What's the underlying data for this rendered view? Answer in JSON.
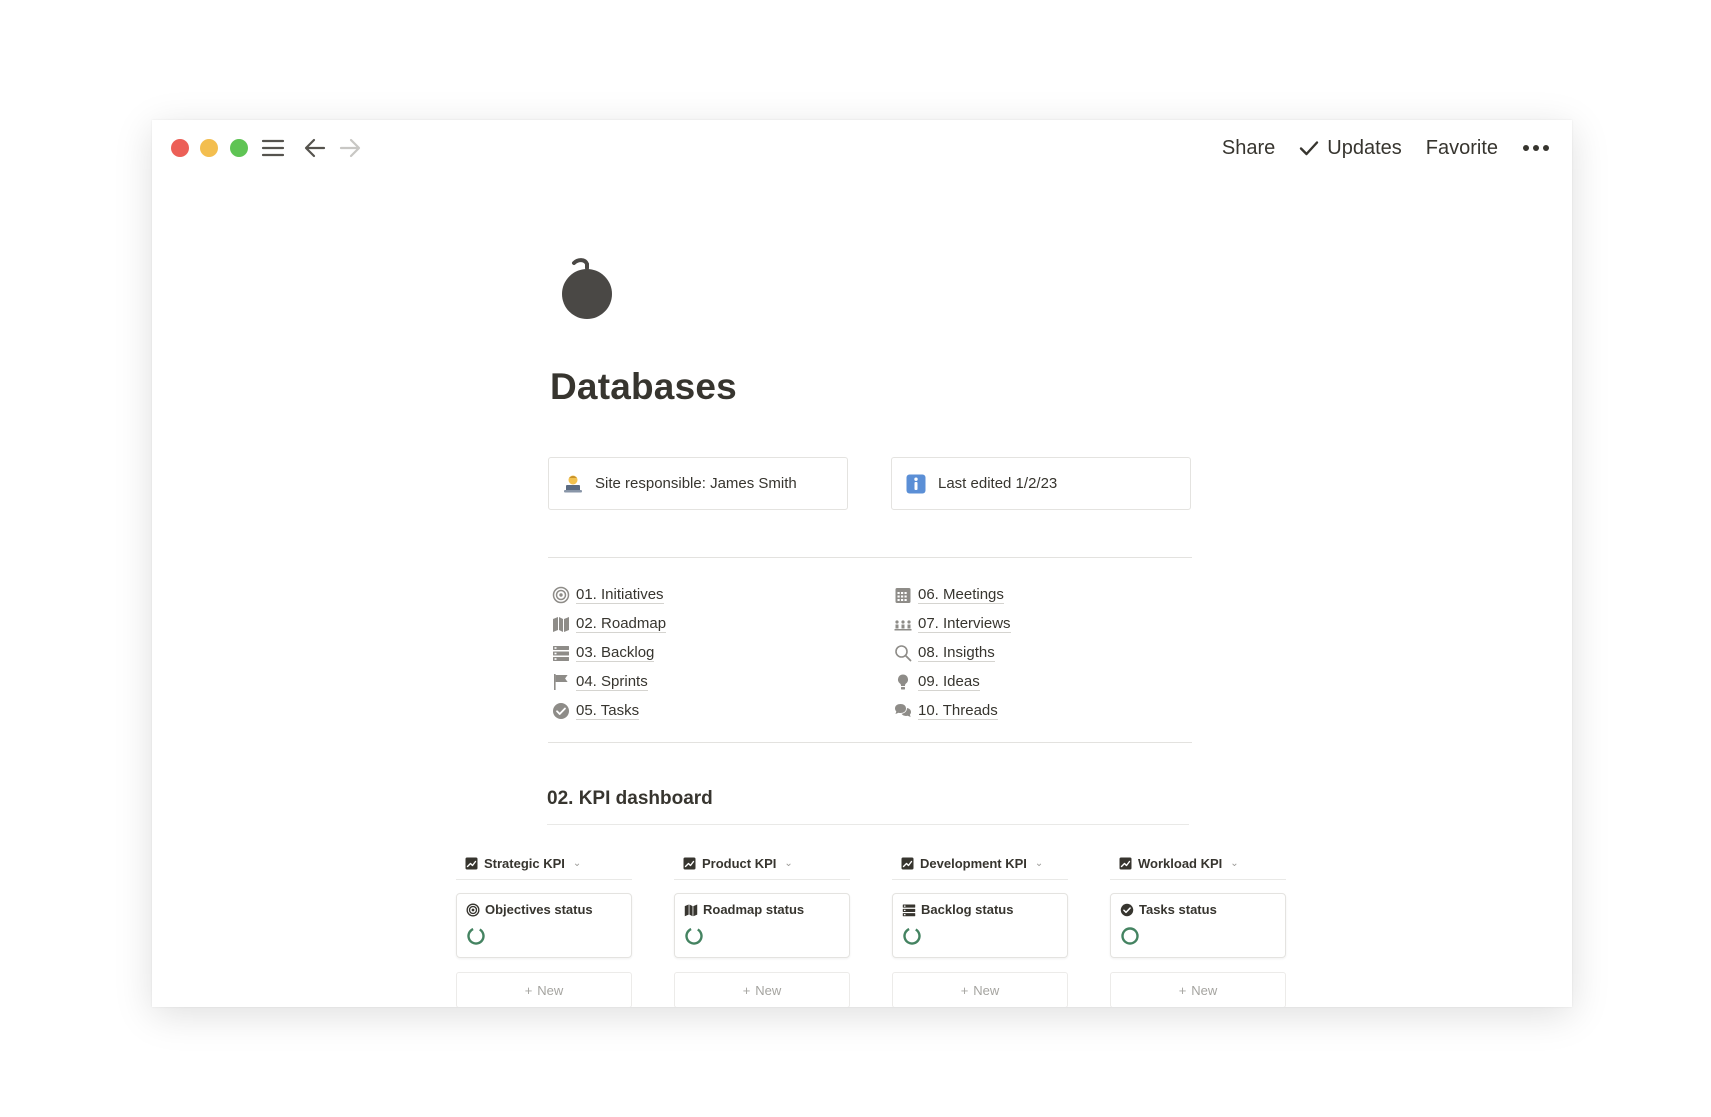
{
  "titlebar": {
    "share_label": "Share",
    "updates_label": "Updates",
    "favorite_label": "Favorite",
    "icons": [
      "menu-icon",
      "back-arrow-icon",
      "forward-arrow-icon",
      "check-icon",
      "more-icon"
    ]
  },
  "page": {
    "icon": "apple-icon",
    "title": "Databases"
  },
  "callouts": [
    {
      "icon": "person-at-laptop-icon",
      "text": "Site responsible: James Smith"
    },
    {
      "icon": "info-icon",
      "text": "Last edited 1/2/23"
    }
  ],
  "links_left": [
    {
      "icon": "target-icon",
      "label": "01. Initiatives"
    },
    {
      "icon": "map-icon",
      "label": "02. Roadmap"
    },
    {
      "icon": "stack-icon",
      "label": "03. Backlog"
    },
    {
      "icon": "flag-icon",
      "label": "04. Sprints"
    },
    {
      "icon": "checkmark-circle-icon",
      "label": "05. Tasks"
    }
  ],
  "links_right": [
    {
      "icon": "calendar-icon",
      "label": "06. Meetings"
    },
    {
      "icon": "people-icon",
      "label": "07. Interviews"
    },
    {
      "icon": "magnifier-icon",
      "label": "08. Insigths"
    },
    {
      "icon": "lightbulb-icon",
      "label": "09. Ideas"
    },
    {
      "icon": "chat-bubbles-icon",
      "label": "10. Threads"
    }
  ],
  "kpi_dashboard": {
    "title": "02. KPI dashboard",
    "columns": [
      {
        "header": "Strategic KPI",
        "card_title": "Objectives status",
        "card_icon": "target-icon",
        "new_label": "New"
      },
      {
        "header": "Product KPI",
        "card_title": "Roadmap status",
        "card_icon": "map-icon",
        "new_label": "New"
      },
      {
        "header": "Development KPI",
        "card_title": "Backlog status",
        "card_icon": "stack-icon",
        "new_label": "New"
      },
      {
        "header": "Workload KPI",
        "card_title": "Tasks status",
        "card_icon": "checkmark-circle-icon",
        "new_label": "New"
      }
    ]
  },
  "colors": {
    "text": "#37352f",
    "ring_green": "#448361",
    "traffic_red": "#ec5f57",
    "traffic_yellow": "#f3be4f",
    "traffic_green": "#5fc454"
  }
}
